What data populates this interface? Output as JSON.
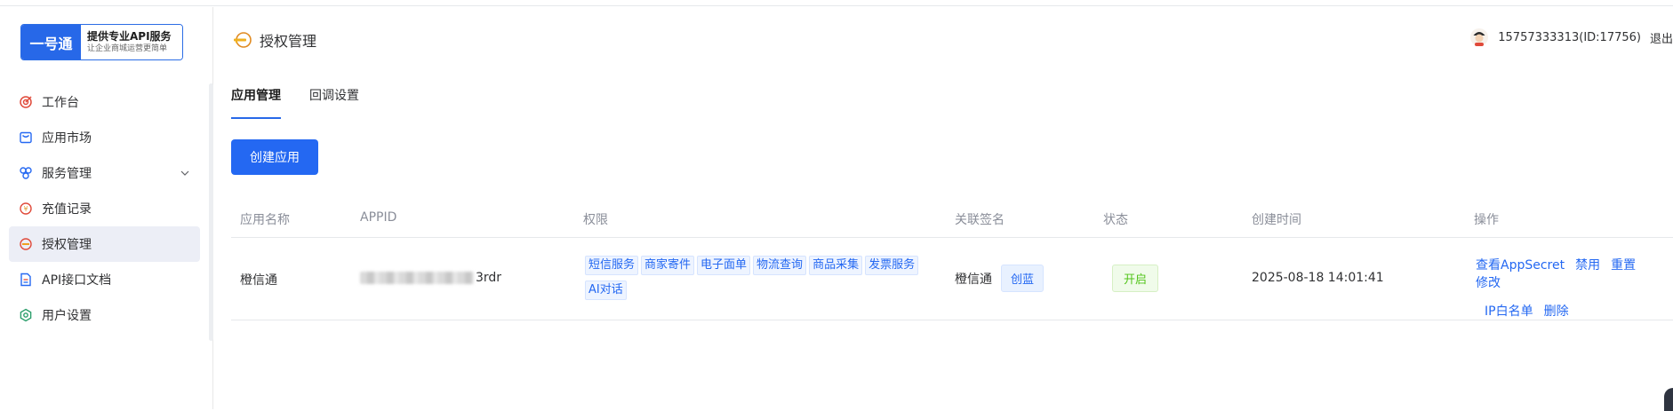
{
  "logo": {
    "brand": "一号通",
    "line1": "提供专业API服务",
    "line2": "让企业商城运营更简单"
  },
  "sidebar": {
    "items": [
      {
        "label": "工作台",
        "icon": "dashboard-icon"
      },
      {
        "label": "应用市场",
        "icon": "market-icon"
      },
      {
        "label": "服务管理",
        "icon": "service-icon",
        "has_children": true
      },
      {
        "label": "充值记录",
        "icon": "recharge-icon"
      },
      {
        "label": "授权管理",
        "icon": "key-icon",
        "active": true
      },
      {
        "label": "API接口文档",
        "icon": "document-icon"
      },
      {
        "label": "用户设置",
        "icon": "settings-icon"
      }
    ]
  },
  "header": {
    "title": "授权管理",
    "user": "15757333313(ID:17756)",
    "logout": "退出"
  },
  "tabs": [
    {
      "label": "应用管理",
      "active": true
    },
    {
      "label": "回调设置",
      "active": false
    }
  ],
  "toolbar": {
    "create_label": "创建应用"
  },
  "table": {
    "columns": [
      "应用名称",
      "APPID",
      "权限",
      "关联签名",
      "状态",
      "创建时间",
      "操作"
    ],
    "rows": [
      {
        "name": "橙信通",
        "appid_suffix": "3rdr",
        "permissions": [
          "短信服务",
          "商家寄件",
          "电子面单",
          "物流查询",
          "商品采集",
          "发票服务",
          "AI对话"
        ],
        "signature": "橙信通",
        "signature_tag": "创蓝",
        "status": "开启",
        "created": "2025-08-18 14:01:41",
        "actions": [
          "查看AppSecret",
          "禁用",
          "重置",
          "修改",
          "IP白名单",
          "删除"
        ]
      }
    ]
  },
  "colors": {
    "primary": "#2468f2",
    "success": "#52c41a",
    "active_bg": "#eceef6"
  }
}
